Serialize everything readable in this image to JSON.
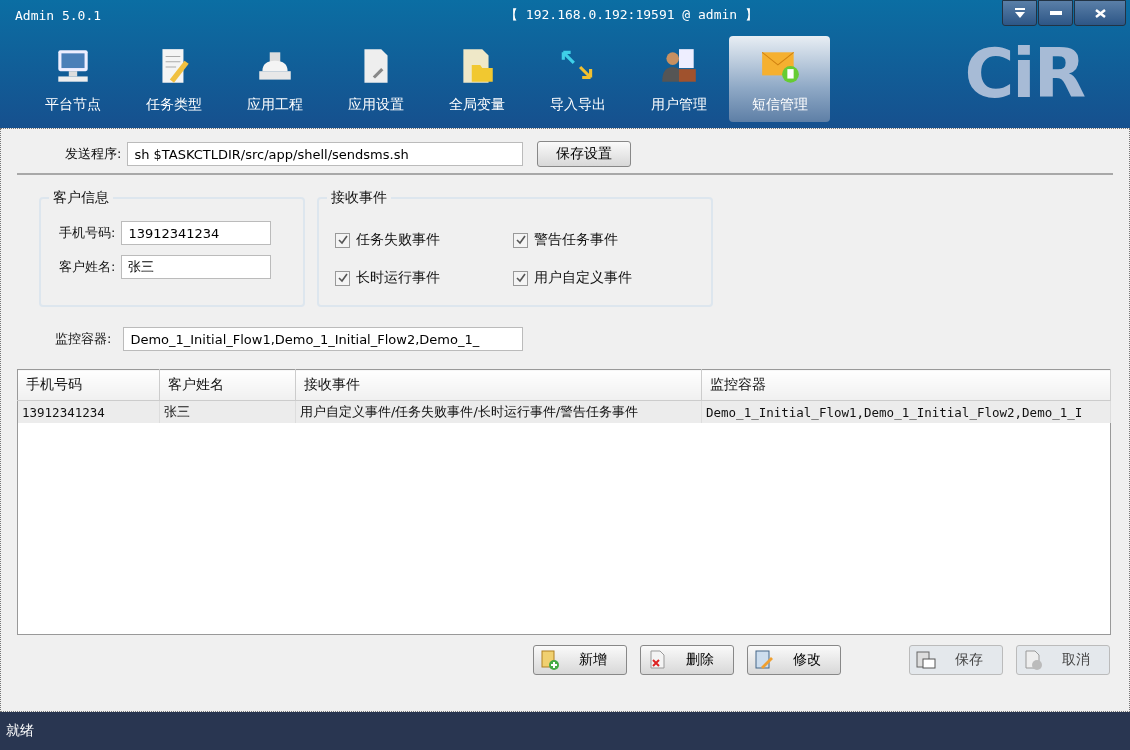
{
  "window": {
    "title": "Admin 5.0.1",
    "connection": "【 192.168.0.192:19591 @ admin 】",
    "logo": "CiR"
  },
  "toolbar": [
    {
      "label": "平台节点",
      "selected": false
    },
    {
      "label": "任务类型",
      "selected": false
    },
    {
      "label": "应用工程",
      "selected": false
    },
    {
      "label": "应用设置",
      "selected": false
    },
    {
      "label": "全局变量",
      "selected": false
    },
    {
      "label": "导入导出",
      "selected": false
    },
    {
      "label": "用户管理",
      "selected": false
    },
    {
      "label": "短信管理",
      "selected": true
    }
  ],
  "send_program": {
    "label": "发送程序:",
    "value": "sh $TASKCTLDIR/src/app/shell/sendsms.sh",
    "button": "保存设置"
  },
  "customer_info": {
    "title": "客户信息",
    "phone_label": "手机号码:",
    "phone": "13912341234",
    "name_label": "客户姓名:",
    "name": "张三"
  },
  "events": {
    "title": "接收事件",
    "items": [
      {
        "label": "任务失败事件",
        "checked": true
      },
      {
        "label": "警告任务事件",
        "checked": true
      },
      {
        "label": "长时运行事件",
        "checked": true
      },
      {
        "label": "用户自定义事件",
        "checked": true
      }
    ]
  },
  "monitor": {
    "label": "监控容器:",
    "value": "Demo_1_Initial_Flow1,Demo_1_Initial_Flow2,Demo_1_"
  },
  "table": {
    "columns": [
      "手机号码",
      "客户姓名",
      "接收事件",
      "监控容器"
    ],
    "rows": [
      {
        "cells": [
          "13912341234",
          "张三",
          "用户自定义事件/任务失败事件/长时运行事件/警告任务事件",
          "Demo_1_Initial_Flow1,Demo_1_Initial_Flow2,Demo_1_I"
        ],
        "selected": true
      }
    ]
  },
  "buttons": [
    {
      "label": "新增",
      "disabled": false
    },
    {
      "label": "删除",
      "disabled": false
    },
    {
      "label": "修改",
      "disabled": false
    },
    {
      "label": "保存",
      "disabled": true
    },
    {
      "label": "取消",
      "disabled": true
    }
  ],
  "status_bar": "就绪"
}
